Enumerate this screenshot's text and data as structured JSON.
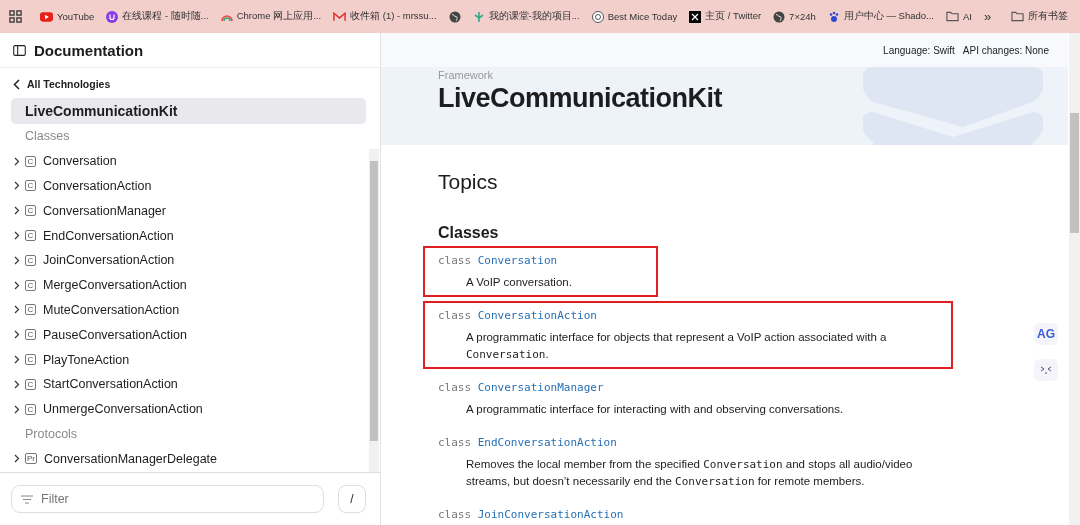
{
  "bookmarks_bar": {
    "items": [
      {
        "label": "YouTube",
        "kind": "youtube"
      },
      {
        "label": "在线课程 - 随时随...",
        "kind": "course"
      },
      {
        "label": "Chrome 网上应用...",
        "kind": "rainbow"
      },
      {
        "label": "收件箱 (1) - mrssu...",
        "kind": "mail"
      },
      {
        "kind": "globe"
      },
      {
        "label": "我的课堂-我的项目...",
        "kind": "tree"
      },
      {
        "label": "Best Mice Today",
        "kind": "spiral"
      },
      {
        "label": "主页 / Twitter",
        "kind": "x"
      },
      {
        "label": "7×24h",
        "kind": "globe"
      },
      {
        "label": "用户中心 — Shado...",
        "kind": "paw"
      },
      {
        "label": "AI",
        "kind": "folder"
      }
    ],
    "more": "»",
    "all_bookmarks": "所有书签"
  },
  "header": {
    "title": "Documentation",
    "language_label": "Language:",
    "language": "Swift",
    "api_label": "API changes:",
    "api": "None"
  },
  "sidebar": {
    "back": "All Technologies",
    "technology": {
      "label": "LiveCommunicationKit",
      "selected": true
    },
    "sections": [
      {
        "heading": "Classes",
        "items": [
          {
            "label": "Conversation",
            "badge": "C",
            "expanded": false
          },
          {
            "label": "ConversationAction",
            "badge": "C",
            "expanded": false
          },
          {
            "label": "ConversationManager",
            "badge": "C",
            "expanded": false
          },
          {
            "label": "EndConversationAction",
            "badge": "C",
            "expanded": false
          },
          {
            "label": "JoinConversationAction",
            "badge": "C",
            "expanded": false
          },
          {
            "label": "MergeConversationAction",
            "badge": "C",
            "expanded": false
          },
          {
            "label": "MuteConversationAction",
            "badge": "C",
            "expanded": false
          },
          {
            "label": "PauseConversationAction",
            "badge": "C",
            "expanded": false
          },
          {
            "label": "PlayToneAction",
            "badge": "C",
            "expanded": false
          },
          {
            "label": "StartConversationAction",
            "badge": "C",
            "expanded": false
          },
          {
            "label": "UnmergeConversationAction",
            "badge": "C",
            "expanded": false
          }
        ]
      },
      {
        "heading": "Protocols",
        "items": [
          {
            "label": "ConversationManagerDelegate",
            "badge": "Pr",
            "expanded": false
          }
        ]
      }
    ],
    "filter": {
      "placeholder": "Filter"
    },
    "shortcut": "/"
  },
  "main": {
    "eyebrow": "Framework",
    "title": "LiveCommunicationKit",
    "topics_heading": "Topics",
    "group_heading": "Classes",
    "topics": [
      {
        "keyword": "class",
        "name": "Conversation",
        "highlighted": true,
        "description": [
          {
            "text": "A VoIP conversation.",
            "code": false
          }
        ]
      },
      {
        "keyword": "class",
        "name": "ConversationAction",
        "highlighted": true,
        "description": [
          {
            "text": "A programmatic interface for objects that represent a VoIP action associated with a ",
            "code": false
          },
          {
            "text": "Conversation",
            "code": true
          },
          {
            "text": ".",
            "code": false
          }
        ]
      },
      {
        "keyword": "class",
        "name": "ConversationManager",
        "highlighted": false,
        "description": [
          {
            "text": "A programmatic interface for interacting with and observing conversations.",
            "code": false
          }
        ]
      },
      {
        "keyword": "class",
        "name": "EndConversationAction",
        "highlighted": false,
        "description": [
          {
            "text": "Removes the local member from the specified ",
            "code": false
          },
          {
            "text": "Conversation",
            "code": true
          },
          {
            "text": " and stops all audio/video streams, but doesn’t necessarily end the ",
            "code": false
          },
          {
            "text": "Conversation",
            "code": true
          },
          {
            "text": " for remote members.",
            "code": false
          }
        ]
      },
      {
        "keyword": "class",
        "name": "JoinConversationAction",
        "highlighted": false
      }
    ]
  },
  "side_tools": [
    {
      "label": "AG",
      "kind": "text"
    },
    {
      "kind": "face"
    }
  ]
}
